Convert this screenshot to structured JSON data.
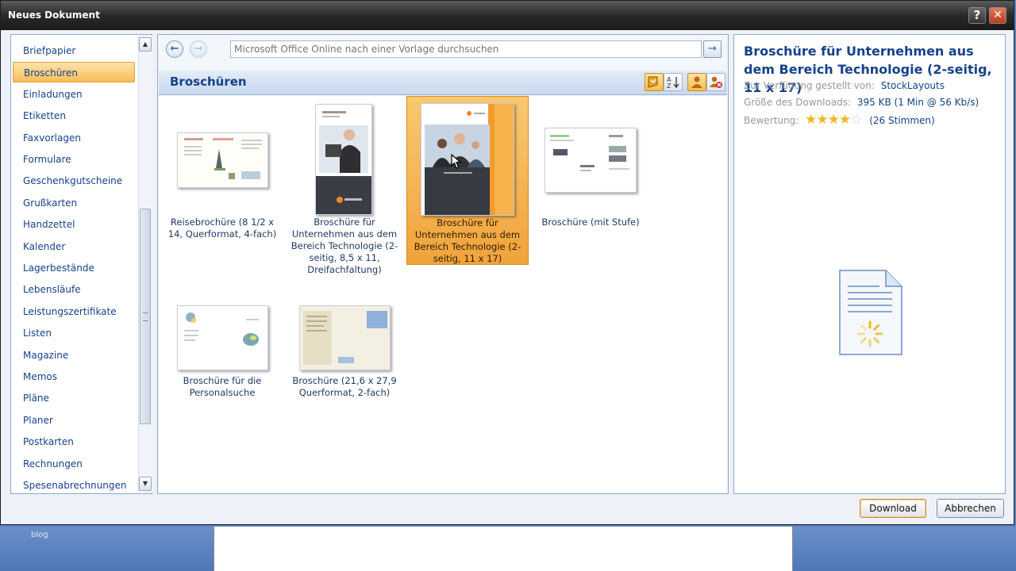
{
  "background": {
    "blog_label": "blog"
  },
  "dialog": {
    "title": "Neues Dokument",
    "help_label": "?",
    "close_label": "✕"
  },
  "categories": [
    "Briefpapier",
    "Broschüren",
    "Einladungen",
    "Etiketten",
    "Faxvorlagen",
    "Formulare",
    "Geschenkgutscheine",
    "Grußkarten",
    "Handzettel",
    "Kalender",
    "Lagerbestände",
    "Lebensläufe",
    "Leistungszertifikate",
    "Listen",
    "Magazine",
    "Memos",
    "Pläne",
    "Planer",
    "Postkarten",
    "Rechnungen",
    "Spesenabrechnungen"
  ],
  "selected_category_index": 1,
  "search": {
    "placeholder": "Microsoft Office Online nach einer Vorlage durchsuchen"
  },
  "section": {
    "title": "Broschüren"
  },
  "templates": [
    {
      "caption": "Reisebrochüre (8 1/2 x 14, Querformat, 4-fach)",
      "selected": false
    },
    {
      "caption": "Broschüre für Unternehmen aus dem Bereich Technologie (2-seitig, 8,5 x 11, Dreifachfaltung)",
      "selected": false
    },
    {
      "caption": "Broschüre für Unternehmen aus dem Bereich Technologie (2-seitig, 11 x 17)",
      "selected": true
    },
    {
      "caption": "Broschüre (mit Stufe)",
      "selected": false
    },
    {
      "caption": "Broschüre für die Personalsuche",
      "selected": false
    },
    {
      "caption": "Broschüre (21,6 x 27,9 Querformat, 2-fach)",
      "selected": false
    }
  ],
  "details": {
    "title": "Broschüre für Unternehmen aus dem Bereich Technologie (2-seitig, 11 x 17)",
    "provided_by_label": "Zur Verfügung gestellt von:",
    "provided_by": "StockLayouts",
    "size_label": "Größe des Downloads:",
    "size": "395 KB (1 Min @ 56 Kb/s)",
    "rating_label": "Bewertung:",
    "rating_stars": 4,
    "rating_votes": "(26 Stimmen)"
  },
  "buttons": {
    "download": "Download",
    "cancel": "Abbrechen"
  },
  "colors": {
    "accent_orange": "#f0a33b",
    "text_blue": "#15428b"
  }
}
